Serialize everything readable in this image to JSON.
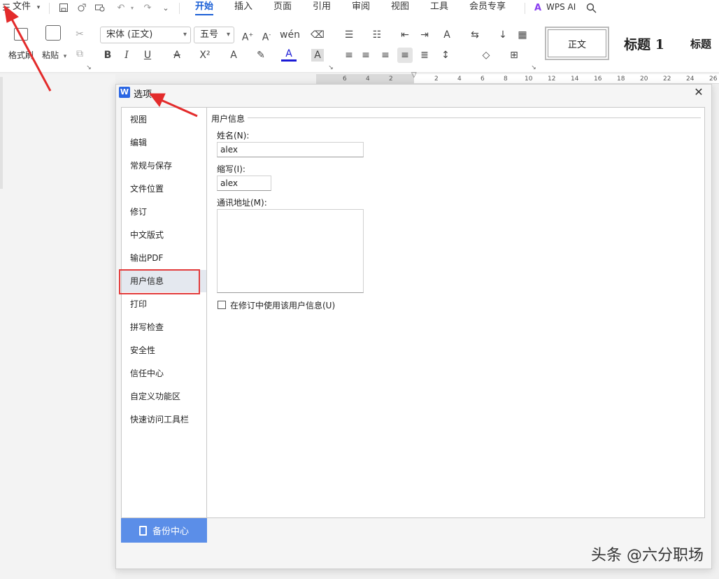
{
  "menubar": {
    "file": "文件",
    "tabs": [
      "开始",
      "插入",
      "页面",
      "引用",
      "审阅",
      "视图",
      "工具",
      "会员专享"
    ],
    "active_tab": "开始",
    "wps_ai": "WPS AI"
  },
  "ribbon": {
    "format_painter": "格式刷",
    "paste": "粘贴",
    "font_name": "宋体 (正文)",
    "font_size": "五号",
    "styles": [
      "正文",
      "标题 1",
      "标题"
    ]
  },
  "ruler": {
    "ticks": [
      "6",
      "4",
      "2",
      "2",
      "4",
      "6",
      "8",
      "10",
      "12",
      "14",
      "16",
      "18",
      "20",
      "22",
      "24",
      "26"
    ]
  },
  "dialog": {
    "title": "选项",
    "close": "✕",
    "nav_items": [
      "视图",
      "编辑",
      "常规与保存",
      "文件位置",
      "修订",
      "中文版式",
      "输出PDF",
      "用户信息",
      "打印",
      "拼写检查",
      "安全性",
      "信任中心",
      "自定义功能区",
      "快速访问工具栏"
    ],
    "active_nav": "用户信息",
    "backup": "备份中心",
    "section_title": "用户信息",
    "name_label": "姓名(N):",
    "name_value": "alex",
    "initials_label": "缩写(I):",
    "initials_value": "alex",
    "address_label": "通讯地址(M):",
    "address_value": "",
    "use_info_checkbox": "在修订中使用该用户信息(U)"
  },
  "watermark": "头条 @六分职场",
  "colors": {
    "accent": "#1a5fd6",
    "backup_bg": "#5b8ee8",
    "highlight": "#e23b3b",
    "wps_logo": "#2a66e3"
  }
}
